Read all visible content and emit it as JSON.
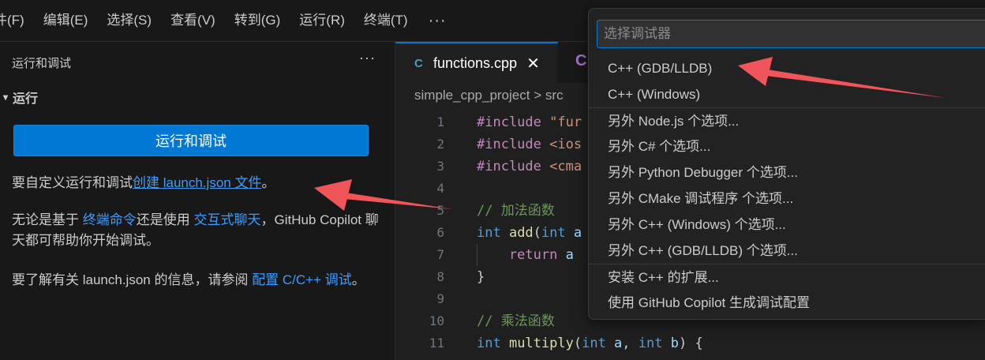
{
  "menubar": {
    "items": [
      "件(F)",
      "编辑(E)",
      "选择(S)",
      "查看(V)",
      "转到(G)",
      "运行(R)",
      "终端(T)"
    ],
    "more": "···"
  },
  "sidebar": {
    "title": "运行和调试",
    "more": "···",
    "section": "运行",
    "run_button": "运行和调试",
    "para1_prefix": "要自定义运行和调试",
    "para1_link": "创建 launch.json 文件",
    "para1_suffix": "。",
    "para2_a": "无论是基于 ",
    "para2_link1": "终端命令",
    "para2_b": "还是使用 ",
    "para2_link2": "交互式聊天",
    "para2_c": "，GitHub Copilot 聊天都可帮助你开始调试。",
    "para3_a": "要了解有关 launch.json 的信息，请参阅 ",
    "para3_link": "配置 C/C++ 调试",
    "para3_b": "。"
  },
  "editor": {
    "tab_active": "functions.cpp",
    "tab_icon": "C",
    "tab2_icon": "C",
    "breadcrumb": "simple_cpp_project > src",
    "line_numbers": [
      "1",
      "2",
      "3",
      "4",
      "5",
      "6",
      "7",
      "8",
      "9",
      "10",
      "11"
    ],
    "code": {
      "l1_kw": "#include",
      "l1_str": " \"fur",
      "l2_kw": "#include",
      "l2_str": " <ios",
      "l3_kw": "#include",
      "l3_str": " <cma",
      "l5": "// 加法函数",
      "l6_kw": "int",
      "l6_fn": " add",
      "l6_rest": "(",
      "l6_kw2": "int",
      "l6_tail": " a",
      "l7_kw": "    return",
      "l7_rest": " a",
      "l8": "}",
      "l10": "// 乘法函数",
      "l11_kw": "int",
      "l11_fn": " multiply",
      "l11_p1": "(",
      "l11_kw2": "int",
      "l11_a": " a",
      "l11_p2": ", ",
      "l11_kw3": "int",
      "l11_b": " b",
      "l11_p3": ") {"
    }
  },
  "quickpick": {
    "placeholder": "选择调试器",
    "items": [
      "C++ (GDB/LLDB)",
      "C++ (Windows)",
      "另外 Node.js 个选项...",
      "另外 C# 个选项...",
      "另外 Python Debugger 个选项...",
      "另外 CMake 调试程序 个选项...",
      "另外 C++ (Windows) 个选项...",
      "另外 C++ (GDB/LLDB) 个选项...",
      "安装 C++ 的扩展...",
      "使用 GitHub Copilot 生成调试配置"
    ]
  },
  "colors": {
    "accent": "#0078d4",
    "link": "#3b9dff",
    "annotation_arrow": "#f0555a"
  }
}
